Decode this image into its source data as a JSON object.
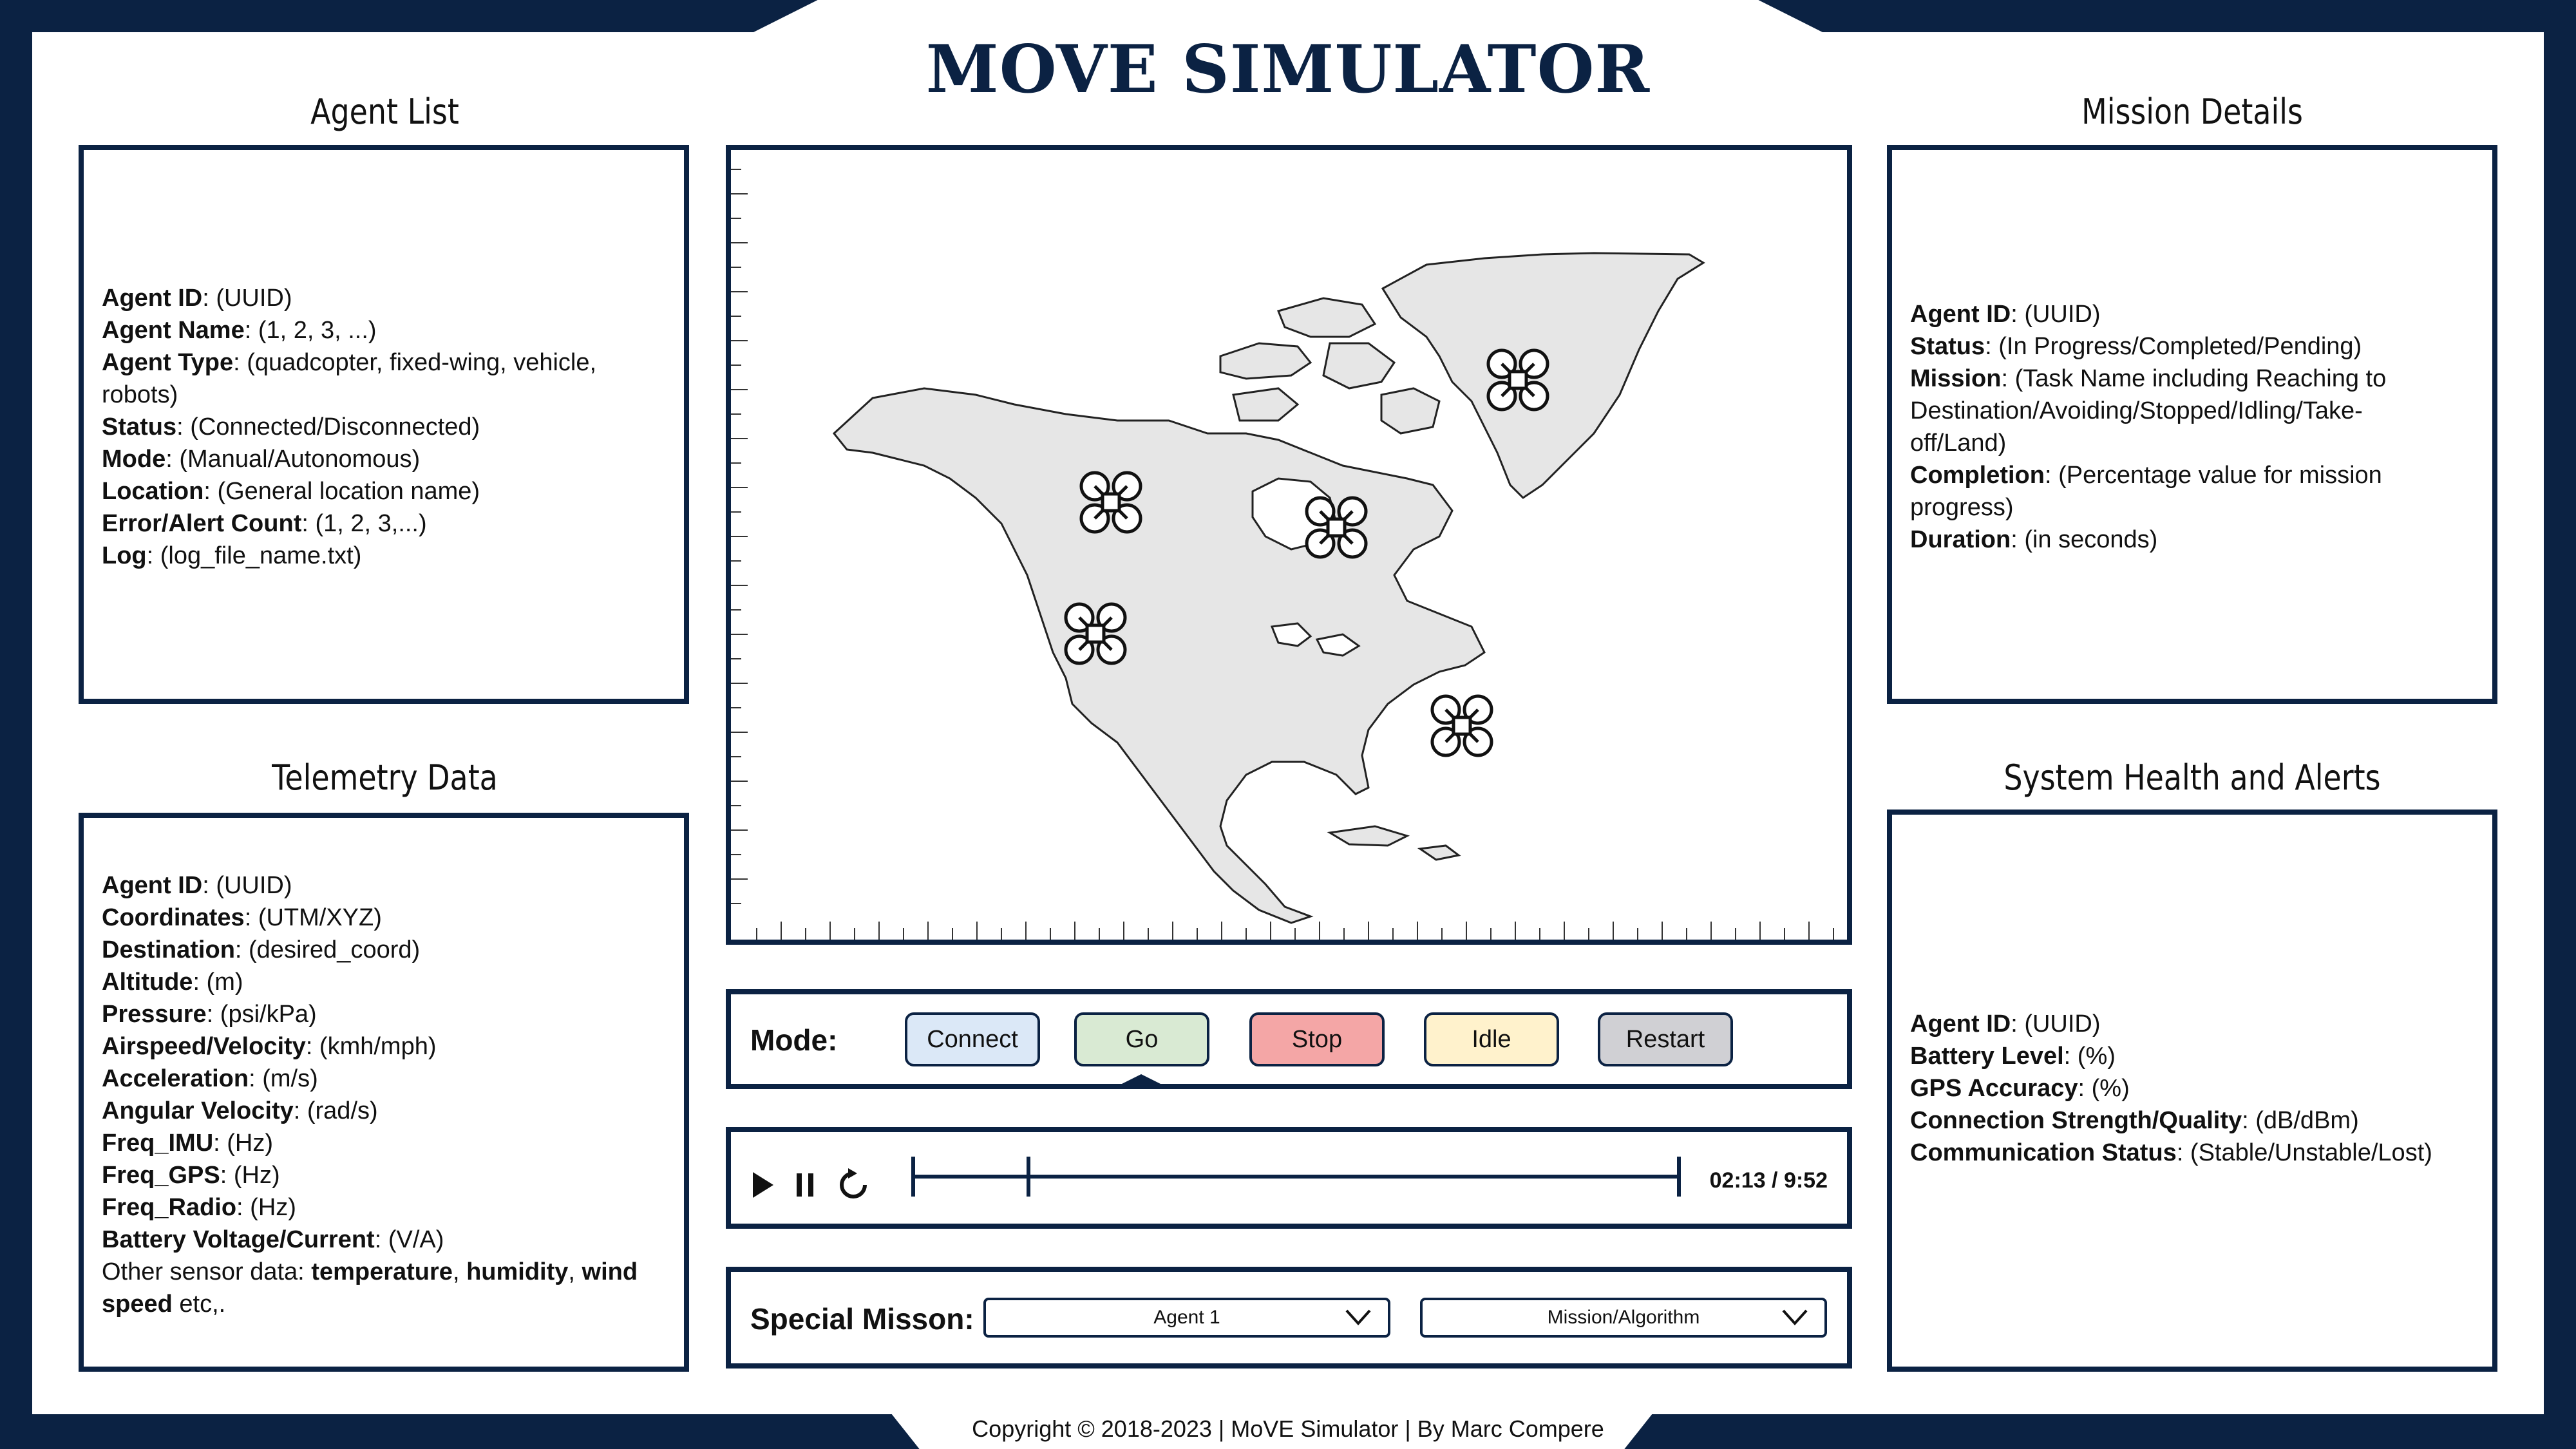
{
  "app": {
    "title": "MOVE SIMULATOR"
  },
  "agent_list": {
    "title": "Agent List",
    "rows": [
      {
        "label": "Agent ID",
        "value": ": (UUID)"
      },
      {
        "label": "Agent Name",
        "value": ": (1, 2, 3, ...)"
      },
      {
        "label": "Agent Type",
        "value": ": (quadcopter, fixed-wing, vehicle,"
      },
      {
        "label": "",
        "value": "robots)"
      },
      {
        "label": "Status",
        "value": ": (Connected/Disconnected)"
      },
      {
        "label": "Mode",
        "value": ": (Manual/Autonomous)"
      },
      {
        "label": "Location",
        "value": ": (General location name)"
      },
      {
        "label": "Error/Alert Count",
        "value": ": (1, 2, 3,...)"
      },
      {
        "label": "Log",
        "value": ": (log_file_name.txt)"
      }
    ]
  },
  "telemetry": {
    "title": "Telemetry Data",
    "rows": [
      {
        "label": "Agent ID",
        "value": ": (UUID)"
      },
      {
        "label": "Coordinates",
        "value": ": (UTM/XYZ)"
      },
      {
        "label": "Destination",
        "value": ": (desired_coord)"
      },
      {
        "label": "Altitude",
        "value": ": (m)"
      },
      {
        "label": "Pressure",
        "value": ": (psi/kPa)"
      },
      {
        "label": "Airspeed/Velocity",
        "value": ": (kmh/mph)"
      },
      {
        "label": "Acceleration",
        "value": ": (m/s)"
      },
      {
        "label": "Angular Velocity",
        "value": ": (rad/s)"
      },
      {
        "label": "Freq_IMU",
        "value": ": (Hz)"
      },
      {
        "label": "Freq_GPS",
        "value": ": (Hz)"
      },
      {
        "label": "Freq_Radio",
        "value": ": (Hz)"
      },
      {
        "label": "Battery Voltage/Current",
        "value": ": (V/A)"
      }
    ],
    "other_prefix": "Other sensor data: ",
    "other_temperature": "temperature",
    "other_comma1": ", ",
    "other_humidity": "humidity",
    "other_comma2": ", ",
    "other_wind": "wind",
    "other_speed": "speed",
    "other_suffix": " etc,."
  },
  "mission": {
    "title": "Mission Details",
    "rows": [
      {
        "label": "Agent ID",
        "value": ": (UUID)"
      },
      {
        "label": "Status",
        "value": ": (In Progress/Completed/Pending)"
      },
      {
        "label": "Mission",
        "value": ": (Task Name including Reaching to"
      },
      {
        "label": "",
        "value": "Destination/Avoiding/Stopped/Idling/Take-"
      },
      {
        "label": "",
        "value": "off/Land)"
      },
      {
        "label": "Completion",
        "value": ": (Percentage value for mission"
      },
      {
        "label": "",
        "value": "progress)"
      },
      {
        "label": "Duration",
        "value": ": (in seconds)"
      }
    ]
  },
  "health": {
    "title": "System Health and Alerts",
    "rows": [
      {
        "label": "Agent ID",
        "value": ": (UUID)"
      },
      {
        "label": "Battery Level",
        "value": ": (%)"
      },
      {
        "label": "GPS Accuracy",
        "value": ": (%)"
      },
      {
        "label": "Connection Strength/Quality",
        "value": ": (dB/dBm)"
      },
      {
        "label": "Communication Status",
        "value": ": (Stable/Unstable/Lost)"
      }
    ]
  },
  "mode_bar": {
    "label": "Mode:",
    "buttons": [
      {
        "label": "Connect",
        "color": "#dbe8f7"
      },
      {
        "label": "Go",
        "color": "#d9ead3"
      },
      {
        "label": "Stop",
        "color": "#f4a6a6"
      },
      {
        "label": "Idle",
        "color": "#fff2cc"
      },
      {
        "label": "Restart",
        "color": "#d0d0d4"
      }
    ]
  },
  "playback": {
    "time": "02:13 / 9:52",
    "progress": 0.15
  },
  "special": {
    "label": "Special Misson:",
    "agent_select": "Agent 1",
    "mission_select": "Mission/Algorithm"
  },
  "footer": {
    "copyright": "Copyright © 2018-2023 | MoVE Simulator | By Marc Compere"
  },
  "colors": {
    "navy": "#0b2243",
    "land": "#e6e6e6"
  },
  "icons": [
    "quadcopter-icon",
    "play-icon",
    "pause-icon",
    "restart-icon",
    "chevron-down-icon"
  ]
}
